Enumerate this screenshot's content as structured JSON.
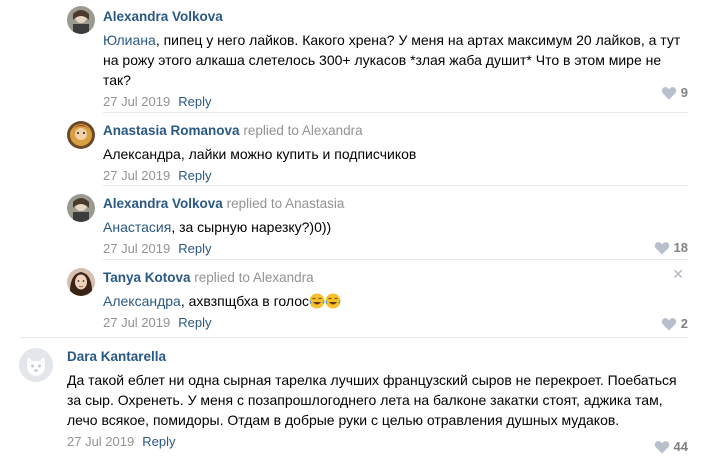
{
  "comments": [
    {
      "author": "Alexandra Volkova",
      "replied_label": "",
      "replied_to": "",
      "mention": "Юлиана",
      "text": ", пипец у него лайков. Какого хрена? У меня на артах максимум 20 лайков, а тут на рожу этого алкаша слетелось 300+ лукасов *злая жаба душит* Что в этом мире не так?",
      "date": "27 Jul 2019",
      "reply_label": "Reply",
      "likes": "9"
    },
    {
      "author": "Anastasia Romanova",
      "replied_label": "replied to",
      "replied_to": "Alexandra",
      "mention": "",
      "text": "Александра, лайки можно купить и подписчиков",
      "date": "27 Jul 2019",
      "reply_label": "Reply",
      "likes": ""
    },
    {
      "author": "Alexandra Volkova",
      "replied_label": "replied to",
      "replied_to": "Anastasia",
      "mention": "Анастасия",
      "text": ", за сырную нарезку?)0))",
      "date": "27 Jul 2019",
      "reply_label": "Reply",
      "likes": "18"
    },
    {
      "author": "Tanya Kotova",
      "replied_label": "replied to",
      "replied_to": "Alexandra",
      "mention": "Александра",
      "text": ", ахвзпщбха в голос",
      "date": "27 Jul 2019",
      "reply_label": "Reply",
      "likes": "2"
    },
    {
      "author": "Dara Kantarella",
      "replied_label": "",
      "replied_to": "",
      "mention": "",
      "text": "Да такой еблет ни одна сырная тарелка лучших французский сыров не перекроет. Поебаться за сыр. Охренеть. У меня с позапрошлогоднего лета на балконе закатки стоят, аджика там, лечо всякое, помидоры. Отдам в добрые руки с целью отравления душных мудаков.",
      "date": "27 Jul 2019",
      "reply_label": "Reply",
      "likes": "44"
    }
  ],
  "close_icon": "✕",
  "colors": {
    "link": "#2a5885",
    "muted": "#939393",
    "divider": "#e7e8ec"
  }
}
